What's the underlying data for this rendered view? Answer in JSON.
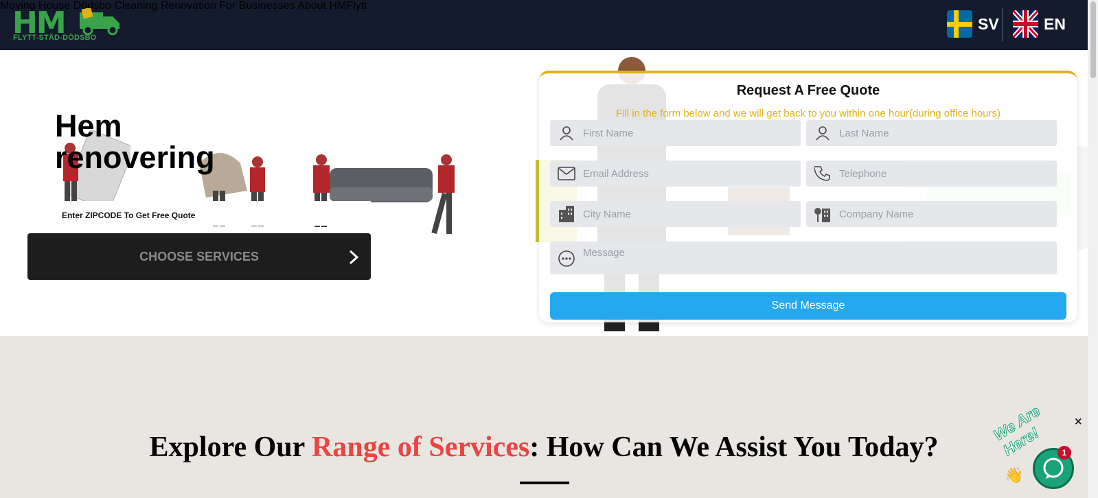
{
  "brand": {
    "logo_text": "HM",
    "tagline": "FLYTT-STÄD-DÖDSBO"
  },
  "nav": {
    "items": [
      {
        "label": "Moving House"
      },
      {
        "label": "Dödsbo"
      },
      {
        "label": "Cleaning"
      },
      {
        "label": "Renovation"
      },
      {
        "label": "For Businesses"
      },
      {
        "label": "About HMFlytt"
      }
    ]
  },
  "languages": [
    {
      "code": "SV",
      "flag": "sweden-flag-icon"
    },
    {
      "code": "EN",
      "flag": "uk-flag-icon"
    }
  ],
  "hero": {
    "title_line1": "Hem",
    "title_line2": "renovering",
    "zip_placeholder": "Enter ZIPCODE To Get Free Quote",
    "choose_button": "CHOOSE SERVICES"
  },
  "quote_form": {
    "title": "Request A Free Quote",
    "subtitle": "Fill in the form below and we will get back to you within one hour(during office hours)",
    "fields": {
      "first_name": "First Name",
      "last_name": "Last Name",
      "email": "Email Address",
      "telephone": "Telephone",
      "city": "City Name",
      "company": "Company Name",
      "message": "Message"
    },
    "submit": "Send Message"
  },
  "services": {
    "heading_pre": "Explore Our ",
    "heading_highlight": "Range of Services",
    "heading_post": ": How Can We Assist You Today?"
  },
  "chat": {
    "label": "We Are Here!",
    "badge_count": "1",
    "close": "×"
  },
  "colors": {
    "header_bg": "#141b2d",
    "brand_green": "#3aa34a",
    "accent_yellow": "#e2b118",
    "send_blue": "#25a8ef",
    "highlight_red": "#e84545",
    "services_bg": "#e9e6e1",
    "chat_green": "#1aa37a"
  }
}
